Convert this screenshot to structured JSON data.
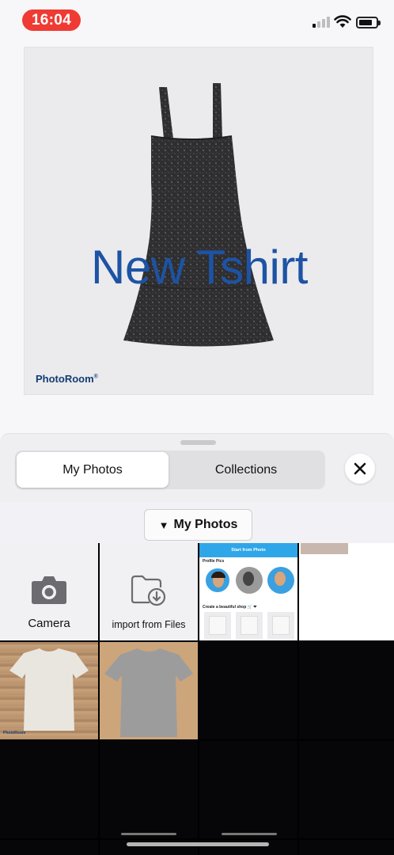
{
  "status_bar": {
    "time": "16:04"
  },
  "preview": {
    "overlay_text": "New Tshirt",
    "brand": "PhotoRoom",
    "text_color": "#1d53a4"
  },
  "sheet": {
    "tabs": [
      {
        "label": "My Photos",
        "active": true
      },
      {
        "label": "Collections",
        "active": false
      }
    ],
    "close_icon": "close-icon",
    "album_selector": {
      "arrow": "▼",
      "label": "My Photos"
    }
  },
  "grid": {
    "camera_label": "Camera",
    "import_label": "import from Files",
    "screenshot_thumb": {
      "header": "Start from Photo",
      "section1": "Profile Pics",
      "section2": "Create a beautiful shop 🛒 ❤"
    },
    "thumb_brand": "PhotoRoom"
  }
}
